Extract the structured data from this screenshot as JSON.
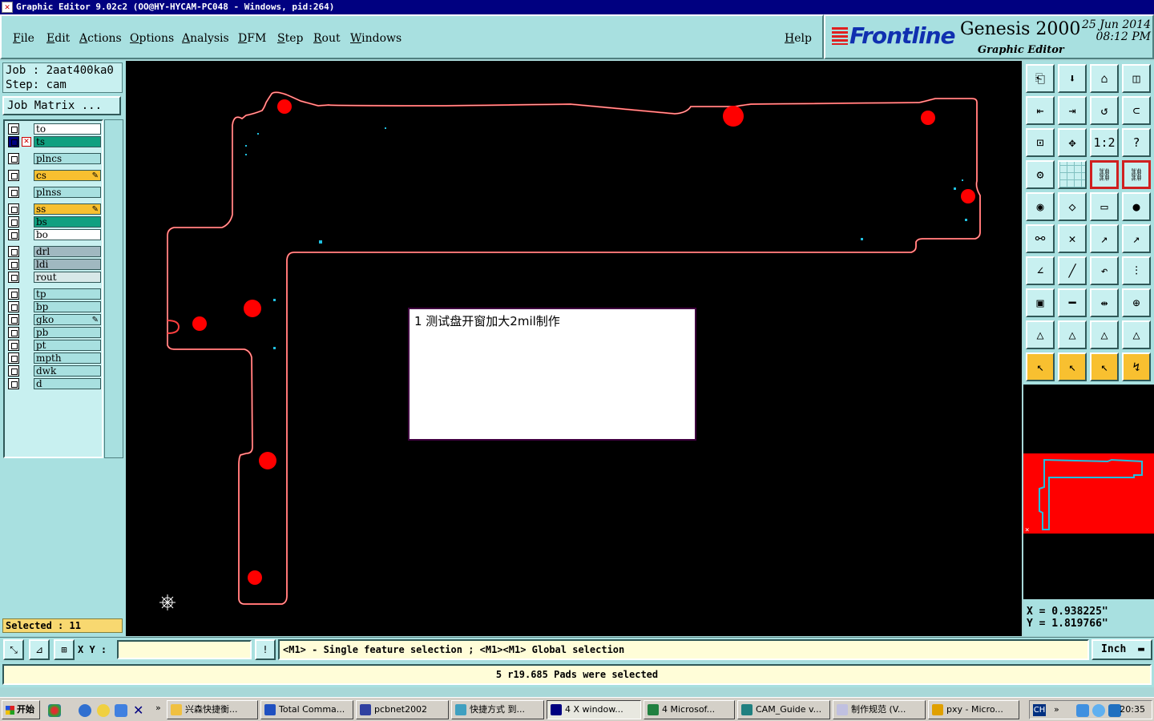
{
  "window": {
    "title": "Graphic Editor 9.02c2  (OO@HY-HYCAM-PC048 - Windows, pid:264)"
  },
  "menu": {
    "items": [
      "File",
      "Edit",
      "Actions",
      "Options",
      "Analysis",
      "DFM",
      "Step",
      "Rout",
      "Windows"
    ],
    "help": "Help"
  },
  "brand": {
    "logo": "Frontline",
    "product": "Genesis 2000",
    "subtitle": "Graphic Editor",
    "date": "25 Jun 2014",
    "time": "08:12 PM"
  },
  "job": {
    "job_line": "Job : 2aat400ka0",
    "step_line": "Step: cam",
    "matrix_button": "Job Matrix ..."
  },
  "layers": [
    {
      "name": "to",
      "color": "#ffffff"
    },
    {
      "name": "ts",
      "color": "#10a080",
      "active": true
    },
    {
      "name": "plncs",
      "color": "#a8e0e0"
    },
    {
      "name": "cs",
      "color": "#f8c030",
      "flag": "✎"
    },
    {
      "name": "plnss",
      "color": "#a8e0e0"
    },
    {
      "name": "ss",
      "color": "#f8c030",
      "flag": "✎"
    },
    {
      "name": "bs",
      "color": "#10a080"
    },
    {
      "name": "bo",
      "color": "#ffffff"
    },
    {
      "name": "drl",
      "color": "#a0b8c0"
    },
    {
      "name": "ldi",
      "color": "#a0b8c0"
    },
    {
      "name": "rout",
      "color": "#d8e8e8"
    },
    {
      "name": "tp",
      "color": "#a8e0e0"
    },
    {
      "name": "bp",
      "color": "#a8e0e0"
    },
    {
      "name": "gko",
      "color": "#a8e0e0",
      "flag": "✎"
    },
    {
      "name": "pb",
      "color": "#a8e0e0"
    },
    {
      "name": "pt",
      "color": "#a8e0e0"
    },
    {
      "name": "mpth",
      "color": "#a8e0e0"
    },
    {
      "name": "dwk",
      "color": "#a8e0e0"
    },
    {
      "name": "d",
      "color": "#a8e0e0"
    }
  ],
  "selection": {
    "text": "Selected : 11"
  },
  "note": {
    "text": "1 测试盘开窗加大2mil制作"
  },
  "toolbar": {
    "icons": [
      "home-view-icon",
      "zoom-window-icon",
      "home-icon",
      "split-view-icon",
      "pan-left-icon",
      "pan-right-icon",
      "redraw-icon",
      "undo-icon",
      "fit-icon",
      "center-icon",
      "ratio-icon",
      "help-icon",
      "settings-icon",
      "grid-icon",
      "snap-icon",
      "snap-alt-icon",
      "select-pad-icon",
      "polygon-icon",
      "ruler-icon",
      "pad-icon",
      "net-icon",
      "delete-icon",
      "move-icon",
      "copy-icon",
      "line-icon",
      "slash-icon",
      "arc-icon",
      "text-icon",
      "add-pad-icon",
      "cut-icon",
      "resize-icon",
      "group-icon",
      "triangle-icon",
      "triangle-up-icon",
      "triangle-mid-icon",
      "triangle-mark-icon",
      "pointer-icon",
      "pointer-box-icon",
      "pointer-alt-icon",
      "pointer-path-icon"
    ],
    "ratio_label": "1:2"
  },
  "coords": {
    "x": "X = 0.938225\"",
    "y": "Y = 1.819766\""
  },
  "input": {
    "xy_label": "X Y :",
    "xy_value": "",
    "hint": "<M1> - Single feature selection ; <M1><M1> Global selection",
    "unit": "Inch",
    "alert": "!"
  },
  "status": {
    "message": "5 r19.685 Pads were selected"
  },
  "taskbar": {
    "start": "开始",
    "tasks": [
      "兴森快捷衡...",
      "Total Comma...",
      "pcbnet2002",
      "快捷方式 到...",
      "4 X window...",
      "4 Microsof...",
      "CAM_Guide v...",
      "制作规范 (V...",
      "pxy - Micro..."
    ],
    "chevron": "»",
    "lang": "CH",
    "clock": "20:35"
  },
  "colors": {
    "canvas": "#000000",
    "outline": "#ff4040",
    "pad": "#ff0000",
    "fiducial": "#20c0e0",
    "panel": "#a8e0e0"
  }
}
